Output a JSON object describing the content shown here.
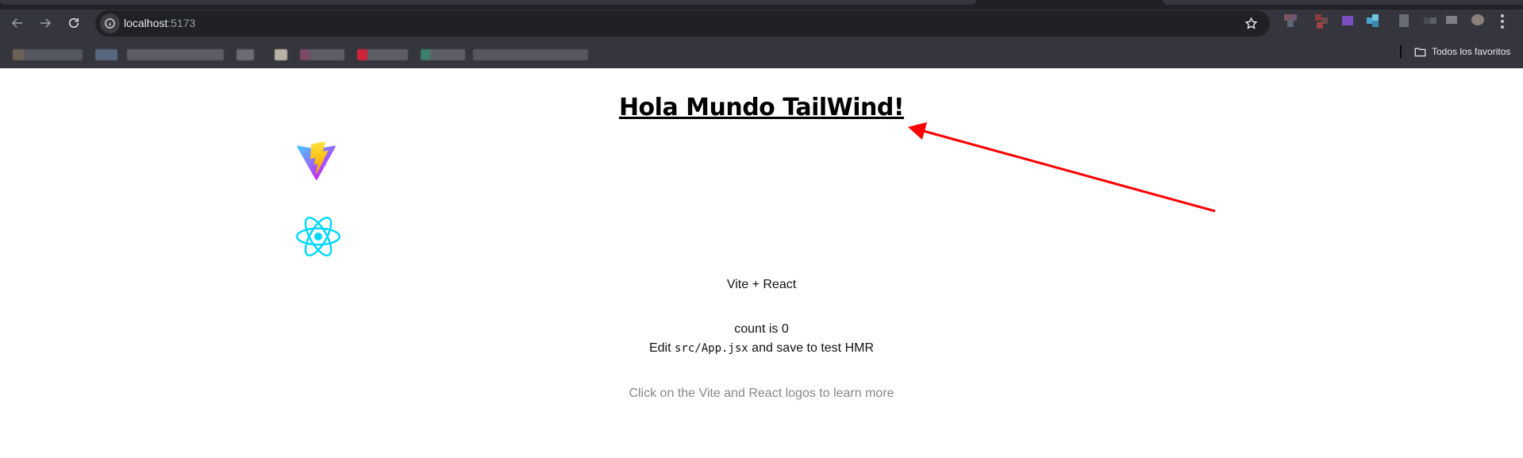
{
  "browser": {
    "url_host": "localhost",
    "url_port": ":5173",
    "bookmarks_folder_label": "Todos los favoritos",
    "icons": {
      "back": "arrow-left-icon",
      "forward": "arrow-right-icon",
      "reload": "reload-icon",
      "site_info": "info-icon",
      "bookmark": "star-icon",
      "menu": "more-vertical-icon",
      "folder": "folder-icon"
    }
  },
  "page": {
    "heading": "Hola Mundo TailWind!",
    "subtitle": "Vite + React",
    "count_label": "count is 0",
    "edit_prefix": "Edit ",
    "edit_code": "src/App.jsx",
    "edit_suffix": " and save to test HMR",
    "hint": "Click on the Vite and React logos to learn more"
  },
  "annotation": {
    "arrow_color": "#ff0000"
  },
  "colors": {
    "chrome_bg": "#35363d",
    "omnibox_bg": "#202124",
    "react_cyan": "#00d8ff",
    "hint_gray": "#888888"
  }
}
